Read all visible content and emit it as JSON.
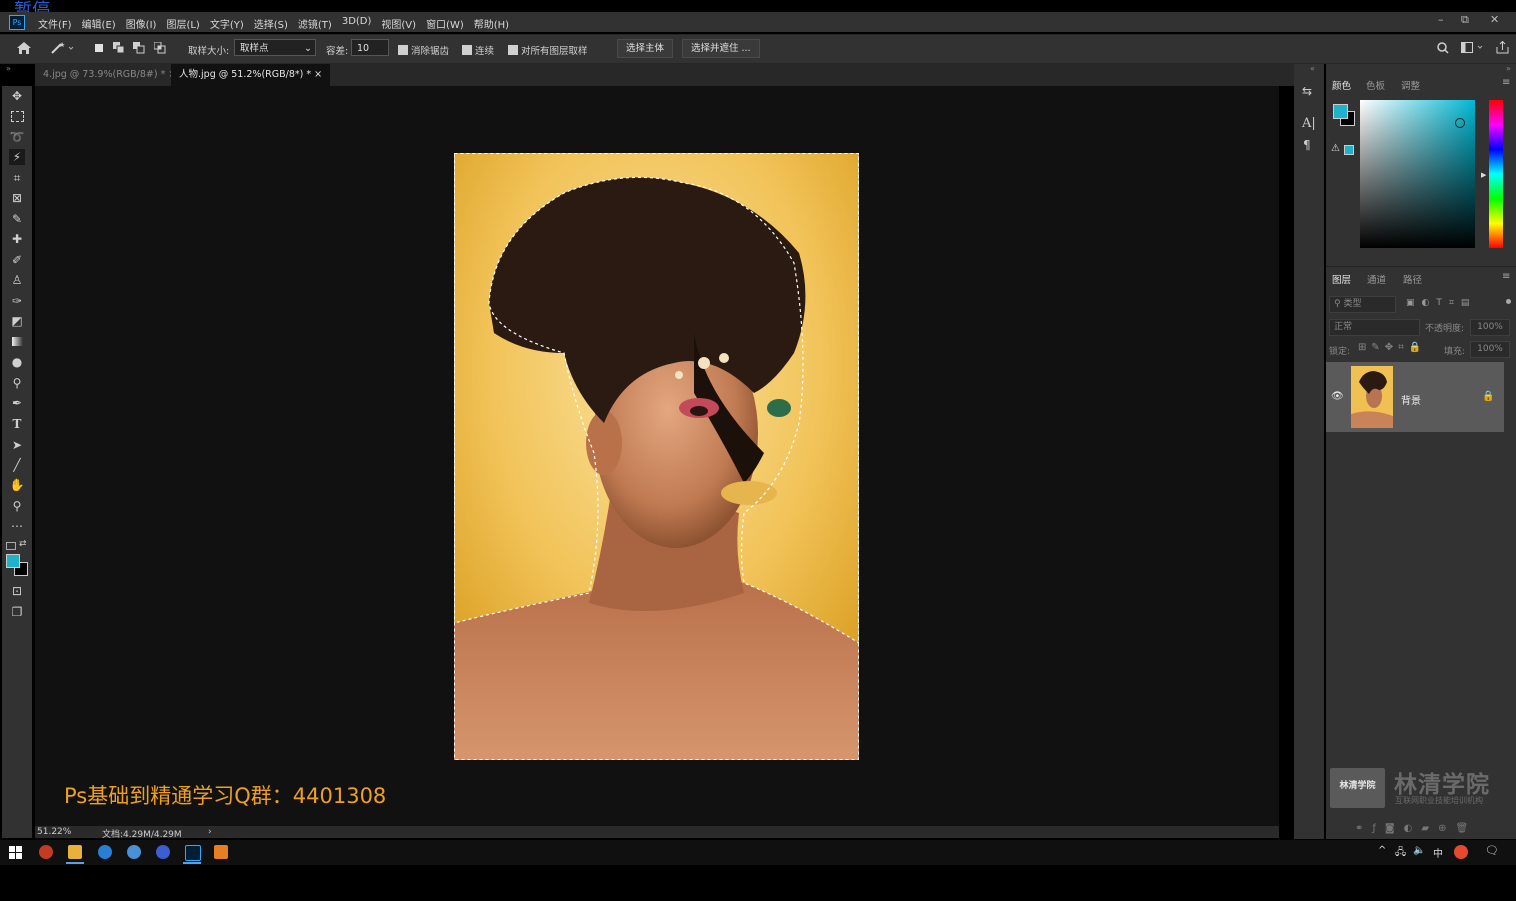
{
  "overlay": {
    "pause_text": "暂停"
  },
  "app": {
    "logo_text": "Ps"
  },
  "menu": [
    "文件(F)",
    "编辑(E)",
    "图像(I)",
    "图层(L)",
    "文字(Y)",
    "选择(S)",
    "滤镜(T)",
    "3D(D)",
    "视图(V)",
    "窗口(W)",
    "帮助(H)"
  ],
  "window_controls": {
    "minimize": "–",
    "restore": "⧉",
    "close": "✕"
  },
  "options": {
    "sample_size_label": "取样大小:",
    "sample_size_value": "取样点",
    "tolerance_label": "容差:",
    "tolerance_value": "10",
    "antialias_label": "消除锯齿",
    "contiguous_label": "连续",
    "sample_all_label": "对所有图层取样",
    "select_subject_button": "选择主体",
    "select_mask_button": "选择并遮住 ..."
  },
  "tabs": [
    {
      "label": "4.jpg @ 73.9%(RGB/8#) *",
      "active": false
    },
    {
      "label": "人物.jpg @ 51.2%(RGB/8*) *",
      "active": true
    }
  ],
  "tab_close": "×",
  "canvas_watermark": "Ps基础到精通学习Q群：4401308",
  "status": {
    "zoom": "51.22%",
    "doc": "文档:4.29M/4.29M",
    "arrow": "›"
  },
  "color_panel": {
    "tabs": [
      "颜色",
      "色板",
      "调整"
    ],
    "foreground_color": "#1fb2c8",
    "background_color": "#000000"
  },
  "layers_panel": {
    "tabs": [
      "图层",
      "通道",
      "路径"
    ],
    "filter_placeholder": "类型",
    "blend_mode": "正常",
    "opacity_label": "不透明度:",
    "opacity_value": "100%",
    "lock_label": "锁定:",
    "fill_label": "填充:",
    "fill_value": "100%",
    "layers": [
      {
        "name": "背景",
        "visible": true,
        "locked": true
      }
    ]
  },
  "brand_watermark": {
    "logo_text": "林清学院",
    "title": "林清学院",
    "subtitle": "互联网职业技能培训机构"
  },
  "taskbar": {
    "ime": "中",
    "tray_arrow": "^"
  }
}
